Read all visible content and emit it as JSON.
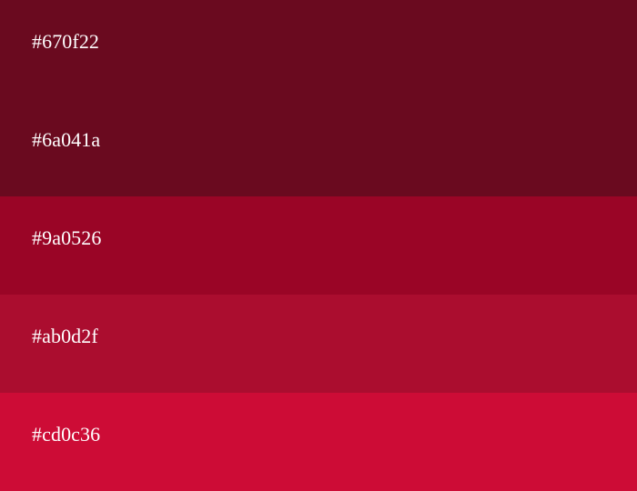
{
  "palette": {
    "swatches": [
      {
        "hex": "#670f22",
        "color": "#6a0a1f"
      },
      {
        "hex": "#6a041a",
        "color": "#6a0a1f"
      },
      {
        "hex": "#9a0526",
        "color": "#9a0526"
      },
      {
        "hex": "#ab0d2f",
        "color": "#ab0d2f"
      },
      {
        "hex": "#cd0c36",
        "color": "#cd0c36"
      }
    ]
  }
}
